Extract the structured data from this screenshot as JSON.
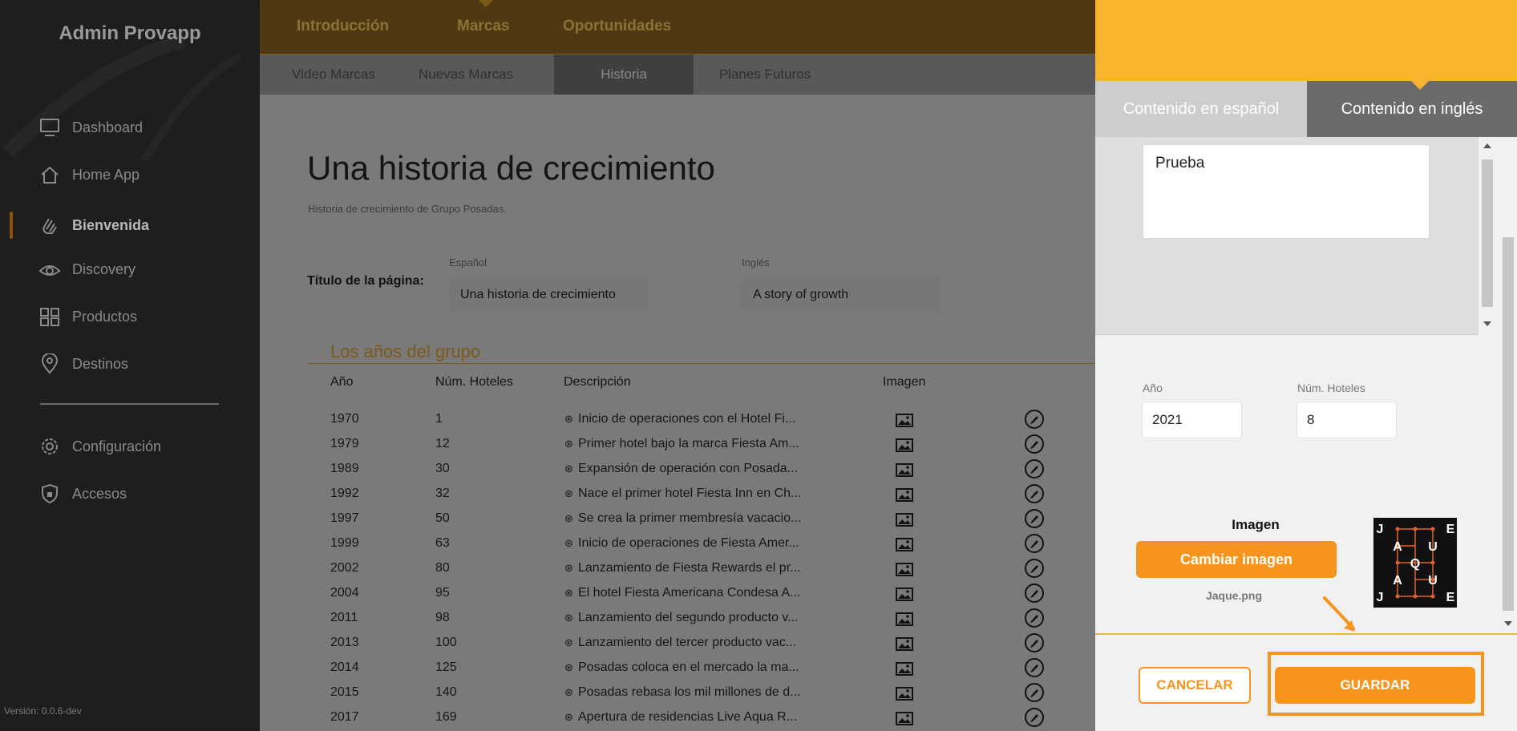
{
  "sidebar": {
    "title": "Admin Provapp",
    "items": [
      {
        "label": "Dashboard",
        "icon": "monitor-icon"
      },
      {
        "label": "Home App",
        "icon": "home-icon"
      },
      {
        "label": "Bienvenida",
        "icon": "wave-hand-icon",
        "active": true
      },
      {
        "label": "Discovery",
        "icon": "eye-icon"
      },
      {
        "label": "Productos",
        "icon": "grid-icon"
      },
      {
        "label": "Destinos",
        "icon": "location-pin-icon"
      },
      {
        "label": "Configuración",
        "icon": "gear-icon"
      },
      {
        "label": "Accesos",
        "icon": "shield-lock-icon"
      }
    ],
    "version": "Versión: 0.0.6-dev"
  },
  "topnav": {
    "tabs": [
      "Introducción",
      "Marcas",
      "Oportunidades"
    ],
    "active": "Marcas"
  },
  "subnav": {
    "tabs": [
      "Video Marcas",
      "Nuevas Marcas",
      "Historia",
      "Planes Futuros"
    ],
    "active": "Historia"
  },
  "main": {
    "title": "Una historia de crecimiento",
    "subtitle": "Historia de crecimiento de Grupo Posadas.",
    "page_title_label": "Título de la página:",
    "es_label": "Español",
    "en_label": "Inglés",
    "es_value": "Una historia de crecimiento",
    "en_value": "A story of growth",
    "section_title": "Los años del grupo",
    "table": {
      "headers": [
        "Año",
        "Núm. Hoteles",
        "Descripción",
        "Imagen"
      ],
      "rows": [
        {
          "year": "1970",
          "hotels": "1",
          "desc": "Inicio de operaciones con el Hotel Fi..."
        },
        {
          "year": "1979",
          "hotels": "12",
          "desc": "Primer hotel bajo la marca Fiesta Am..."
        },
        {
          "year": "1989",
          "hotels": "30",
          "desc": "Expansión de operación con Posada..."
        },
        {
          "year": "1992",
          "hotels": "32",
          "desc": "Nace el primer hotel Fiesta Inn en Ch..."
        },
        {
          "year": "1997",
          "hotels": "50",
          "desc": "Se crea la primer membresía vacacio..."
        },
        {
          "year": "1999",
          "hotels": "63",
          "desc": "Inicio de operaciones de Fiesta Amer..."
        },
        {
          "year": "2002",
          "hotels": "80",
          "desc": "Lanzamiento de Fiesta Rewards el pr..."
        },
        {
          "year": "2004",
          "hotels": "95",
          "desc": "El hotel Fiesta Americana Condesa A..."
        },
        {
          "year": "2011",
          "hotels": "98",
          "desc": "Lanzamiento del segundo producto v..."
        },
        {
          "year": "2013",
          "hotels": "100",
          "desc": "Lanzamiento del tercer producto vac..."
        },
        {
          "year": "2014",
          "hotels": "125",
          "desc": "Posadas coloca en el mercado la ma..."
        },
        {
          "year": "2015",
          "hotels": "140",
          "desc": "Posadas rebasa los mil millones de d..."
        },
        {
          "year": "2017",
          "hotels": "169",
          "desc": "Apertura de residencias Live Aqua R..."
        }
      ]
    }
  },
  "panel": {
    "tabs": [
      "Contenido en español",
      "Contenido en inglés"
    ],
    "active_tab": "Contenido en inglés",
    "textarea_value": "Prueba",
    "year_label": "Año",
    "year_value": "2021",
    "hotels_label": "Núm. Hoteles",
    "hotels_value": "8",
    "image_label": "Imagen",
    "change_image_label": "Cambiar imagen",
    "file_name": "Jaque.png",
    "cancel_label": "CANCELAR",
    "save_label": "GUARDAR",
    "logo_letters": [
      "J",
      "E",
      "A",
      "Q",
      "U",
      "A",
      "U",
      "J",
      "E"
    ]
  },
  "colors": {
    "accent": "#f7941d",
    "header_yellow": "#f7b52f"
  }
}
